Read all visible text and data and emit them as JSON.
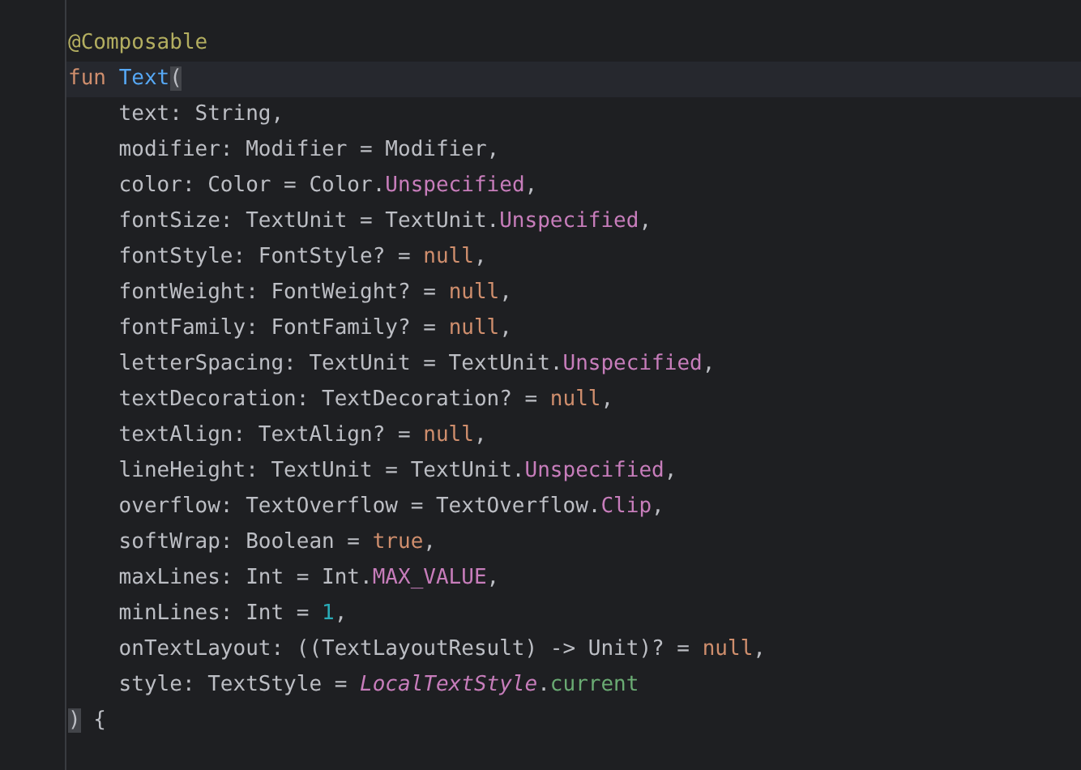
{
  "editor": {
    "lines": [
      {
        "current": false,
        "tokens": [
          {
            "kind": "annotation",
            "text": "@Composable"
          }
        ]
      },
      {
        "current": true,
        "tokens": [
          {
            "kind": "keyword",
            "text": "fun "
          },
          {
            "kind": "function",
            "text": "Text"
          },
          {
            "kind": "bracket",
            "text": "("
          }
        ]
      },
      {
        "current": false,
        "tokens": [
          {
            "kind": "plain",
            "text": "    text: String,"
          }
        ]
      },
      {
        "current": false,
        "tokens": [
          {
            "kind": "plain",
            "text": "    modifier: Modifier = Modifier,"
          }
        ]
      },
      {
        "current": false,
        "tokens": [
          {
            "kind": "plain",
            "text": "    color: Color = Color."
          },
          {
            "kind": "constant",
            "text": "Unspecified"
          },
          {
            "kind": "plain",
            "text": ","
          }
        ]
      },
      {
        "current": false,
        "tokens": [
          {
            "kind": "plain",
            "text": "    fontSize: TextUnit = TextUnit."
          },
          {
            "kind": "constant",
            "text": "Unspecified"
          },
          {
            "kind": "plain",
            "text": ","
          }
        ]
      },
      {
        "current": false,
        "tokens": [
          {
            "kind": "plain",
            "text": "    fontStyle: FontStyle? = "
          },
          {
            "kind": "keyword",
            "text": "null"
          },
          {
            "kind": "plain",
            "text": ","
          }
        ]
      },
      {
        "current": false,
        "tokens": [
          {
            "kind": "plain",
            "text": "    fontWeight: FontWeight? = "
          },
          {
            "kind": "keyword",
            "text": "null"
          },
          {
            "kind": "plain",
            "text": ","
          }
        ]
      },
      {
        "current": false,
        "tokens": [
          {
            "kind": "plain",
            "text": "    fontFamily: FontFamily? = "
          },
          {
            "kind": "keyword",
            "text": "null"
          },
          {
            "kind": "plain",
            "text": ","
          }
        ]
      },
      {
        "current": false,
        "tokens": [
          {
            "kind": "plain",
            "text": "    letterSpacing: TextUnit = TextUnit."
          },
          {
            "kind": "constant",
            "text": "Unspecified"
          },
          {
            "kind": "plain",
            "text": ","
          }
        ]
      },
      {
        "current": false,
        "tokens": [
          {
            "kind": "plain",
            "text": "    textDecoration: TextDecoration? = "
          },
          {
            "kind": "keyword",
            "text": "null"
          },
          {
            "kind": "plain",
            "text": ","
          }
        ]
      },
      {
        "current": false,
        "tokens": [
          {
            "kind": "plain",
            "text": "    textAlign: TextAlign? = "
          },
          {
            "kind": "keyword",
            "text": "null"
          },
          {
            "kind": "plain",
            "text": ","
          }
        ]
      },
      {
        "current": false,
        "tokens": [
          {
            "kind": "plain",
            "text": "    lineHeight: TextUnit = TextUnit."
          },
          {
            "kind": "constant",
            "text": "Unspecified"
          },
          {
            "kind": "plain",
            "text": ","
          }
        ]
      },
      {
        "current": false,
        "tokens": [
          {
            "kind": "plain",
            "text": "    overflow: TextOverflow = TextOverflow."
          },
          {
            "kind": "constant",
            "text": "Clip"
          },
          {
            "kind": "plain",
            "text": ","
          }
        ]
      },
      {
        "current": false,
        "tokens": [
          {
            "kind": "plain",
            "text": "    softWrap: Boolean = "
          },
          {
            "kind": "keyword",
            "text": "true"
          },
          {
            "kind": "plain",
            "text": ","
          }
        ]
      },
      {
        "current": false,
        "tokens": [
          {
            "kind": "plain",
            "text": "    maxLines: Int = Int."
          },
          {
            "kind": "constant",
            "text": "MAX_VALUE"
          },
          {
            "kind": "plain",
            "text": ","
          }
        ]
      },
      {
        "current": false,
        "tokens": [
          {
            "kind": "plain",
            "text": "    minLines: Int = "
          },
          {
            "kind": "number",
            "text": "1"
          },
          {
            "kind": "plain",
            "text": ","
          }
        ]
      },
      {
        "current": false,
        "tokens": [
          {
            "kind": "plain",
            "text": "    onTextLayout: ((TextLayoutResult) -> Unit)? = "
          },
          {
            "kind": "keyword",
            "text": "null"
          },
          {
            "kind": "plain",
            "text": ","
          }
        ]
      },
      {
        "current": false,
        "tokens": [
          {
            "kind": "plain",
            "text": "    style: TextStyle = "
          },
          {
            "kind": "static",
            "text": "LocalTextStyle"
          },
          {
            "kind": "plain",
            "text": "."
          },
          {
            "kind": "property",
            "text": "current"
          }
        ]
      },
      {
        "current": false,
        "tokens": [
          {
            "kind": "bracket",
            "text": ")"
          },
          {
            "kind": "plain",
            "text": " {"
          }
        ]
      }
    ]
  }
}
